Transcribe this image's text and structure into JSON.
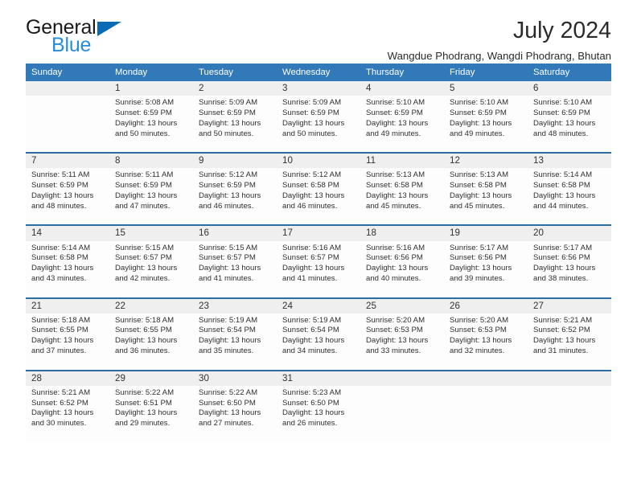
{
  "brand": {
    "line1": "General",
    "line2": "Blue",
    "accent_color": "#2a8bd8",
    "triangle_color": "#0a6ab5"
  },
  "header": {
    "title": "July 2024",
    "subtitle": "Wangdue Phodrang, Wangdi Phodrang, Bhutan"
  },
  "theme": {
    "header_bg": "#3279b9",
    "separator": "#2e6da4",
    "day_number_bg": "#efefef"
  },
  "weekdays": [
    "Sunday",
    "Monday",
    "Tuesday",
    "Wednesday",
    "Thursday",
    "Friday",
    "Saturday"
  ],
  "labels": {
    "sunrise": "Sunrise:",
    "sunset": "Sunset:",
    "daylight": "Daylight:"
  },
  "weeks": [
    [
      {
        "day": ""
      },
      {
        "day": "1",
        "sunrise": "Sunrise: 5:08 AM",
        "sunset": "Sunset: 6:59 PM",
        "daylight_l1": "Daylight: 13 hours",
        "daylight_l2": "and 50 minutes."
      },
      {
        "day": "2",
        "sunrise": "Sunrise: 5:09 AM",
        "sunset": "Sunset: 6:59 PM",
        "daylight_l1": "Daylight: 13 hours",
        "daylight_l2": "and 50 minutes."
      },
      {
        "day": "3",
        "sunrise": "Sunrise: 5:09 AM",
        "sunset": "Sunset: 6:59 PM",
        "daylight_l1": "Daylight: 13 hours",
        "daylight_l2": "and 50 minutes."
      },
      {
        "day": "4",
        "sunrise": "Sunrise: 5:10 AM",
        "sunset": "Sunset: 6:59 PM",
        "daylight_l1": "Daylight: 13 hours",
        "daylight_l2": "and 49 minutes."
      },
      {
        "day": "5",
        "sunrise": "Sunrise: 5:10 AM",
        "sunset": "Sunset: 6:59 PM",
        "daylight_l1": "Daylight: 13 hours",
        "daylight_l2": "and 49 minutes."
      },
      {
        "day": "6",
        "sunrise": "Sunrise: 5:10 AM",
        "sunset": "Sunset: 6:59 PM",
        "daylight_l1": "Daylight: 13 hours",
        "daylight_l2": "and 48 minutes."
      }
    ],
    [
      {
        "day": "7",
        "sunrise": "Sunrise: 5:11 AM",
        "sunset": "Sunset: 6:59 PM",
        "daylight_l1": "Daylight: 13 hours",
        "daylight_l2": "and 48 minutes."
      },
      {
        "day": "8",
        "sunrise": "Sunrise: 5:11 AM",
        "sunset": "Sunset: 6:59 PM",
        "daylight_l1": "Daylight: 13 hours",
        "daylight_l2": "and 47 minutes."
      },
      {
        "day": "9",
        "sunrise": "Sunrise: 5:12 AM",
        "sunset": "Sunset: 6:59 PM",
        "daylight_l1": "Daylight: 13 hours",
        "daylight_l2": "and 46 minutes."
      },
      {
        "day": "10",
        "sunrise": "Sunrise: 5:12 AM",
        "sunset": "Sunset: 6:58 PM",
        "daylight_l1": "Daylight: 13 hours",
        "daylight_l2": "and 46 minutes."
      },
      {
        "day": "11",
        "sunrise": "Sunrise: 5:13 AM",
        "sunset": "Sunset: 6:58 PM",
        "daylight_l1": "Daylight: 13 hours",
        "daylight_l2": "and 45 minutes."
      },
      {
        "day": "12",
        "sunrise": "Sunrise: 5:13 AM",
        "sunset": "Sunset: 6:58 PM",
        "daylight_l1": "Daylight: 13 hours",
        "daylight_l2": "and 45 minutes."
      },
      {
        "day": "13",
        "sunrise": "Sunrise: 5:14 AM",
        "sunset": "Sunset: 6:58 PM",
        "daylight_l1": "Daylight: 13 hours",
        "daylight_l2": "and 44 minutes."
      }
    ],
    [
      {
        "day": "14",
        "sunrise": "Sunrise: 5:14 AM",
        "sunset": "Sunset: 6:58 PM",
        "daylight_l1": "Daylight: 13 hours",
        "daylight_l2": "and 43 minutes."
      },
      {
        "day": "15",
        "sunrise": "Sunrise: 5:15 AM",
        "sunset": "Sunset: 6:57 PM",
        "daylight_l1": "Daylight: 13 hours",
        "daylight_l2": "and 42 minutes."
      },
      {
        "day": "16",
        "sunrise": "Sunrise: 5:15 AM",
        "sunset": "Sunset: 6:57 PM",
        "daylight_l1": "Daylight: 13 hours",
        "daylight_l2": "and 41 minutes."
      },
      {
        "day": "17",
        "sunrise": "Sunrise: 5:16 AM",
        "sunset": "Sunset: 6:57 PM",
        "daylight_l1": "Daylight: 13 hours",
        "daylight_l2": "and 41 minutes."
      },
      {
        "day": "18",
        "sunrise": "Sunrise: 5:16 AM",
        "sunset": "Sunset: 6:56 PM",
        "daylight_l1": "Daylight: 13 hours",
        "daylight_l2": "and 40 minutes."
      },
      {
        "day": "19",
        "sunrise": "Sunrise: 5:17 AM",
        "sunset": "Sunset: 6:56 PM",
        "daylight_l1": "Daylight: 13 hours",
        "daylight_l2": "and 39 minutes."
      },
      {
        "day": "20",
        "sunrise": "Sunrise: 5:17 AM",
        "sunset": "Sunset: 6:56 PM",
        "daylight_l1": "Daylight: 13 hours",
        "daylight_l2": "and 38 minutes."
      }
    ],
    [
      {
        "day": "21",
        "sunrise": "Sunrise: 5:18 AM",
        "sunset": "Sunset: 6:55 PM",
        "daylight_l1": "Daylight: 13 hours",
        "daylight_l2": "and 37 minutes."
      },
      {
        "day": "22",
        "sunrise": "Sunrise: 5:18 AM",
        "sunset": "Sunset: 6:55 PM",
        "daylight_l1": "Daylight: 13 hours",
        "daylight_l2": "and 36 minutes."
      },
      {
        "day": "23",
        "sunrise": "Sunrise: 5:19 AM",
        "sunset": "Sunset: 6:54 PM",
        "daylight_l1": "Daylight: 13 hours",
        "daylight_l2": "and 35 minutes."
      },
      {
        "day": "24",
        "sunrise": "Sunrise: 5:19 AM",
        "sunset": "Sunset: 6:54 PM",
        "daylight_l1": "Daylight: 13 hours",
        "daylight_l2": "and 34 minutes."
      },
      {
        "day": "25",
        "sunrise": "Sunrise: 5:20 AM",
        "sunset": "Sunset: 6:53 PM",
        "daylight_l1": "Daylight: 13 hours",
        "daylight_l2": "and 33 minutes."
      },
      {
        "day": "26",
        "sunrise": "Sunrise: 5:20 AM",
        "sunset": "Sunset: 6:53 PM",
        "daylight_l1": "Daylight: 13 hours",
        "daylight_l2": "and 32 minutes."
      },
      {
        "day": "27",
        "sunrise": "Sunrise: 5:21 AM",
        "sunset": "Sunset: 6:52 PM",
        "daylight_l1": "Daylight: 13 hours",
        "daylight_l2": "and 31 minutes."
      }
    ],
    [
      {
        "day": "28",
        "sunrise": "Sunrise: 5:21 AM",
        "sunset": "Sunset: 6:52 PM",
        "daylight_l1": "Daylight: 13 hours",
        "daylight_l2": "and 30 minutes."
      },
      {
        "day": "29",
        "sunrise": "Sunrise: 5:22 AM",
        "sunset": "Sunset: 6:51 PM",
        "daylight_l1": "Daylight: 13 hours",
        "daylight_l2": "and 29 minutes."
      },
      {
        "day": "30",
        "sunrise": "Sunrise: 5:22 AM",
        "sunset": "Sunset: 6:50 PM",
        "daylight_l1": "Daylight: 13 hours",
        "daylight_l2": "and 27 minutes."
      },
      {
        "day": "31",
        "sunrise": "Sunrise: 5:23 AM",
        "sunset": "Sunset: 6:50 PM",
        "daylight_l1": "Daylight: 13 hours",
        "daylight_l2": "and 26 minutes."
      },
      {
        "day": ""
      },
      {
        "day": ""
      },
      {
        "day": ""
      }
    ]
  ]
}
